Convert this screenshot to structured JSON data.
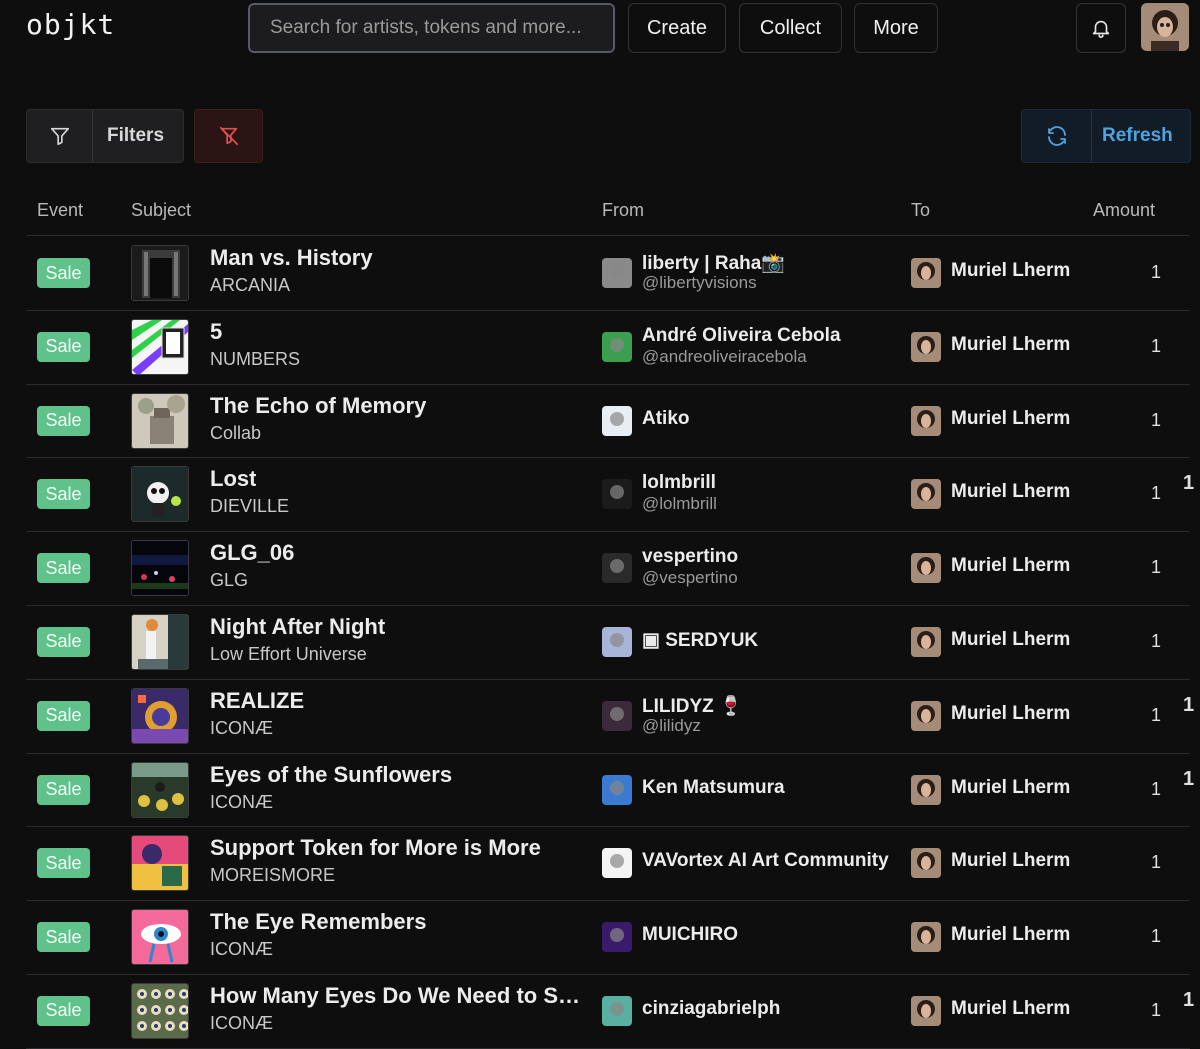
{
  "header": {
    "logo": "objkt",
    "search_placeholder": "Search for artists, tokens and more...",
    "nav": [
      "Create",
      "Collect",
      "More"
    ]
  },
  "toolbar": {
    "filters_label": "Filters",
    "refresh_label": "Refresh"
  },
  "table": {
    "columns": [
      "Event",
      "Subject",
      "From",
      "To",
      "Amount"
    ],
    "rows": [
      {
        "event": "Sale",
        "title": "Man vs. History",
        "collection": "ARCANIA",
        "from_name": "liberty | Raha📸",
        "from_handle": "@libertyvisions",
        "to": "Muriel Lherm",
        "amount": "1"
      },
      {
        "event": "Sale",
        "title": "5",
        "collection": "NUMBERS",
        "from_name": "André Oliveira Cebola",
        "from_handle": "@andreoliveiracebola",
        "to": "Muriel Lherm",
        "amount": "1"
      },
      {
        "event": "Sale",
        "title": "The Echo of Memory",
        "collection": "Collab",
        "from_name": "Atiko",
        "from_handle": "",
        "to": "Muriel Lherm",
        "amount": "1"
      },
      {
        "event": "Sale",
        "title": "Lost",
        "collection": "DIEVILLE",
        "from_name": "lolmbrill",
        "from_handle": "@lolmbrill",
        "to": "Muriel Lherm",
        "amount": "1"
      },
      {
        "event": "Sale",
        "title": "GLG_06",
        "collection": "GLG",
        "from_name": "vespertino",
        "from_handle": "@vespertino",
        "to": "Muriel Lherm",
        "amount": "1"
      },
      {
        "event": "Sale",
        "title": "Night After Night",
        "collection": "Low Effort Universe",
        "from_name": "▣ SERDYUK",
        "from_handle": "",
        "to": "Muriel Lherm",
        "amount": "1"
      },
      {
        "event": "Sale",
        "title": "REALIZE",
        "collection": "ICONÆ",
        "from_name": "LILIDYZ 🍷",
        "from_handle": "@lilidyz",
        "to": "Muriel Lherm",
        "amount": "1"
      },
      {
        "event": "Sale",
        "title": "Eyes of the Sunflowers",
        "collection": "ICONÆ",
        "from_name": "Ken Matsumura",
        "from_handle": "",
        "to": "Muriel Lherm",
        "amount": "1"
      },
      {
        "event": "Sale",
        "title": "Support Token for More is More",
        "collection": "MOREISMORE",
        "from_name": "VAVortex AI Art Community",
        "from_handle": "",
        "to": "Muriel Lherm",
        "amount": "1"
      },
      {
        "event": "Sale",
        "title": "The Eye Remembers",
        "collection": "ICONÆ",
        "from_name": "MUICHIRO",
        "from_handle": "",
        "to": "Muriel Lherm",
        "amount": "1"
      },
      {
        "event": "Sale",
        "title": "How Many Eyes Do We Need to S…",
        "collection": "ICONÆ",
        "from_name": "cinziagabrielph",
        "from_handle": "",
        "to": "Muriel Lherm",
        "amount": "1"
      }
    ]
  },
  "colors": {
    "background": "#0e0e0f",
    "sale_badge": "#5fc28a",
    "refresh_accent": "#4ea3e0",
    "clear_filter": "#e05050"
  },
  "icons": {
    "filter": "funnel-icon",
    "clear": "filter-off-icon",
    "refresh": "refresh-icon",
    "notifications": "bell-icon"
  }
}
